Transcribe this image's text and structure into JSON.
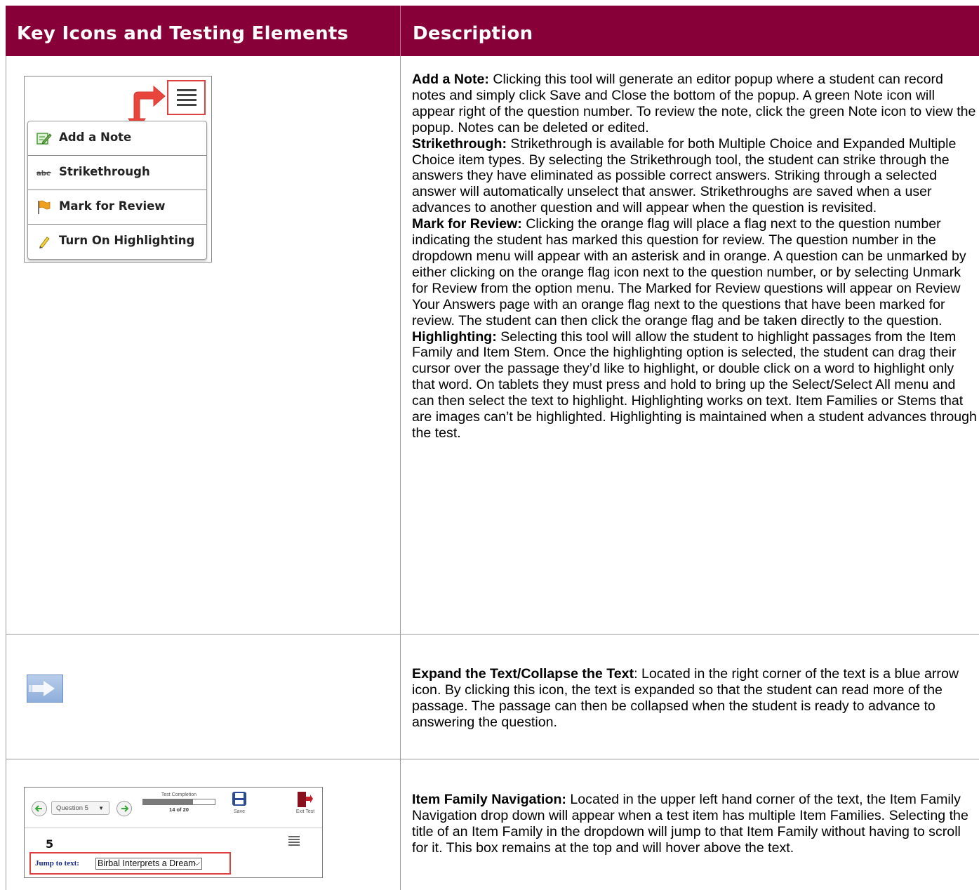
{
  "header": {
    "col1": "Key Icons and Testing Elements",
    "col2": "Description"
  },
  "menu": {
    "items": [
      {
        "label": "Add a Note",
        "icon": "note-edit-icon"
      },
      {
        "label": "Strikethrough",
        "icon": "strikethrough-abc-icon"
      },
      {
        "label": "Mark for Review",
        "icon": "orange-flag-icon"
      },
      {
        "label": "Turn On Highlighting",
        "icon": "highlighter-pen-icon"
      }
    ],
    "colors": {
      "arrow": "#e8453c",
      "highlight_border": "#e04040"
    }
  },
  "row1": {
    "add_note_title": "Add a Note:",
    "add_note_text": " Clicking this tool will generate an editor popup where a student can record notes and simply click Save and Close the bottom of the popup. A green Note icon will appear right of the question number. To review the note, click the green Note icon to view the popup. Notes can be deleted or edited.",
    "strike_title": "Strikethrough:",
    "strike_text": " Strikethrough is available for both Multiple Choice and Expanded Multiple Choice item types. By selecting the Strikethrough tool, the student can strike through the answers they have eliminated as possible correct answers. Striking through a selected answer will automatically unselect that answer. Strikethroughs are saved when a user advances to another question and will appear when the question is revisited.",
    "review_title": "Mark for Review:",
    "review_text": " Clicking the orange flag will place a flag next to the question number indicating the student has marked this question for review. The question number in the dropdown menu will appear with an asterisk and in orange. A question can be unmarked by either clicking on the orange flag icon next to the question number, or by selecting Unmark for Review from the option menu. The Marked for Review questions will appear on Review Your Answers page with an orange flag next to the questions that have been marked for review. The student can then click the orange flag and be taken directly to the question.",
    "highlight_title": "Highlighting:",
    "highlight_text": " Selecting this tool will allow the student to highlight passages from the Item Family and Item Stem. Once the highlighting option is selected, the student can drag their cursor over the passage they’d like to highlight, or double click on a word to highlight only that word. On tablets they must press and hold to bring up the Select/Select All menu and can then select the text to highlight. Highlighting works on text. Item Families or Stems that are images can’t be highlighted. Highlighting is maintained when a student advances through the test."
  },
  "row2": {
    "icon": "expand-arrow-icon",
    "title": "Expand the Text/Collapse the Text",
    "text": ": Located in the right corner of the text is a blue arrow icon. By clicking this icon, the text is expanded so that the student can read more of the passage. The passage can then be collapsed when the student is ready to advance to answering the question."
  },
  "row3": {
    "title": "Item Family Navigation:",
    "text": " Located in the upper left hand corner of the text, the Item Family Navigation drop down will appear when a test item has multiple Item Families. Selecting the title of an Item Family in the dropdown will jump to that Item Family without having to scroll for it. This box remains at the top and will hover above the text.",
    "nav": {
      "question_select": "Question 5",
      "progress_label": "Test Completion",
      "progress_count": "14 of 20",
      "progress_fraction": 0.7,
      "save_label": "Save",
      "exit_label": "Exit Test",
      "question_number": "5",
      "jump_label": "Jump to text:",
      "jump_value": "Birbal Interprets a Dream"
    }
  }
}
